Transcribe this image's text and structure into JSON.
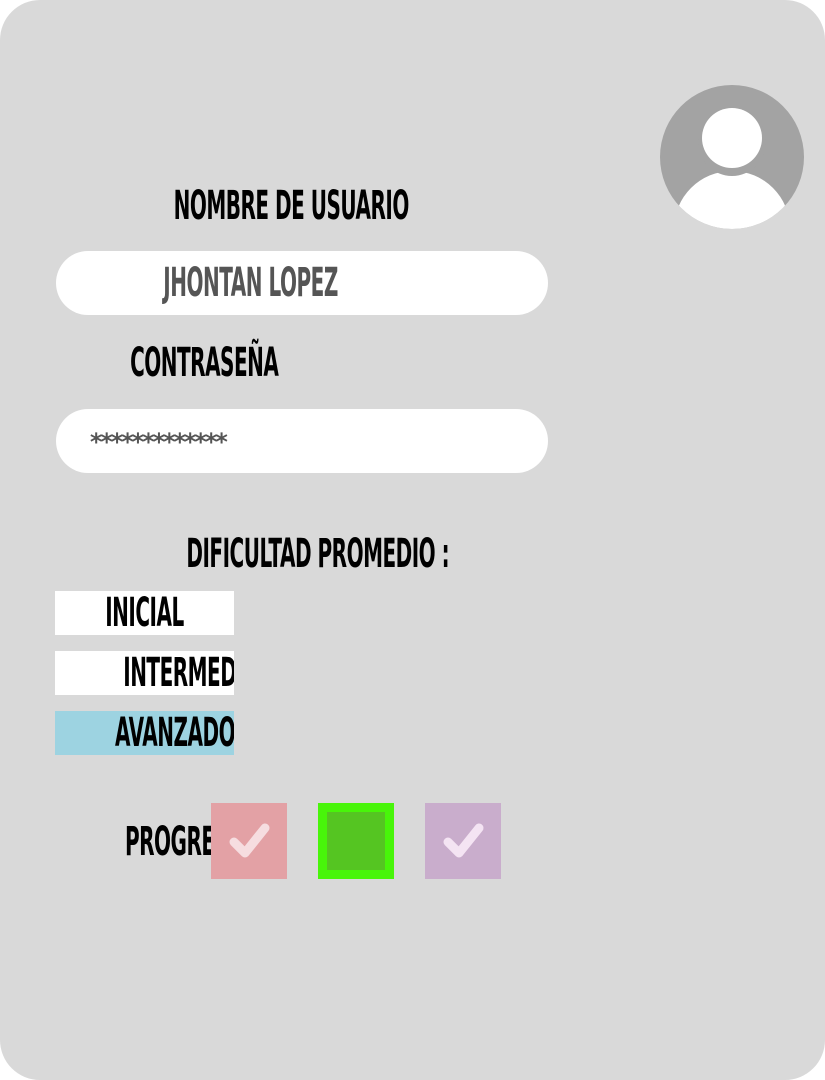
{
  "form": {
    "username_label": "NOMBRE DE USUARIO",
    "username_value": "JHONTAN LOPEZ",
    "password_label": "CONTRASEÑA",
    "password_value": "*************"
  },
  "difficulty": {
    "label": "DIFICULTAD PROMEDIO :",
    "levels": [
      {
        "label": "INICIAL",
        "selected": false
      },
      {
        "label": "INTERMEDIO",
        "selected": false
      },
      {
        "label": "AVANZADO",
        "selected": true
      }
    ]
  },
  "progress": {
    "label": "PROGRESO",
    "boxes": [
      {
        "state": "checked",
        "color": "#e3a1a5"
      },
      {
        "state": "active",
        "color": "#55c522",
        "border": "#48f50a"
      },
      {
        "state": "checked",
        "color": "#c9adcc"
      }
    ]
  },
  "colors": {
    "card": "#d9d9d9",
    "selected_level": "#9dd3e1",
    "avatar": "#a3a3a3"
  },
  "icons": {
    "avatar": "user-avatar-icon",
    "check": "checkmark-icon"
  }
}
